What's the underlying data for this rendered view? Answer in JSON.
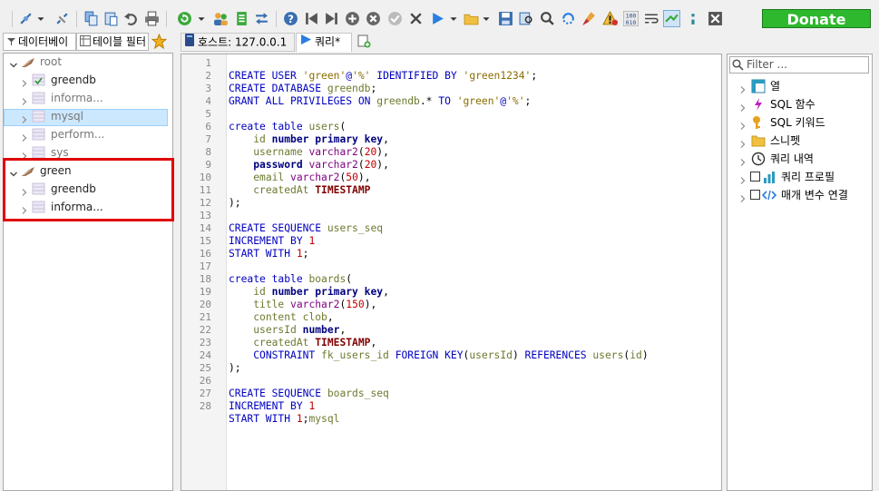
{
  "app": {
    "donate_label": "Donate"
  },
  "colors": {
    "accent_green": "#2db82d",
    "selection_blue": "#cce8ff",
    "highlight_red": "#e00000",
    "keyword_blue": "#0000c0"
  },
  "toolbar_icons": [
    "connect-icon",
    "dropdown-arrow-icon",
    "disconnect-icon",
    "copy-icon",
    "paste-icon",
    "undo-icon",
    "print-icon",
    "refresh-icon",
    "dropdown-arrow-icon",
    "user-manager-icon",
    "export-icon",
    "transfer-icon",
    "help-icon",
    "first-record-icon",
    "last-record-icon",
    "add-record-icon",
    "delete-record-icon",
    "apply-icon",
    "cancel-icon",
    "run-icon",
    "dropdown-arrow-icon",
    "open-folder-icon",
    "dropdown-arrow-icon",
    "save-icon",
    "find-icon",
    "replace-icon",
    "search-icon",
    "clean-icon",
    "warning-icon",
    "binary-icon",
    "wrap-icon",
    "sync-icon",
    "comment-icon",
    "close-icon"
  ],
  "left_tabs": [
    {
      "label": "데이터베이"
    },
    {
      "label": "테이블 필터"
    }
  ],
  "query_tabs": [
    {
      "label": "호스트: 127.0.0.1"
    },
    {
      "label": "쿼리*"
    }
  ],
  "tree": {
    "root": {
      "label": "root",
      "children": [
        "greendb",
        "informa...",
        "mysql",
        "perform...",
        "sys"
      ]
    },
    "green": {
      "label": "green",
      "children": [
        "greendb",
        "informa..."
      ]
    }
  },
  "editor": {
    "lines": [
      "1",
      "2",
      "3",
      "4",
      "5",
      "6",
      "7",
      "8",
      "9",
      "10",
      "11",
      "12",
      "13",
      "14",
      "15",
      "16",
      "17",
      "18",
      "19",
      "20",
      "21",
      "22",
      "23",
      "24",
      "25",
      "26",
      "27",
      "28"
    ]
  },
  "right_panel": {
    "filter_placeholder": "Filter ...",
    "items": [
      {
        "label": "열"
      },
      {
        "label": "SQL 함수"
      },
      {
        "label": "SQL 키워드"
      },
      {
        "label": "스니펫"
      },
      {
        "label": "쿼리 내역"
      },
      {
        "label": "쿼리 프로필"
      },
      {
        "label": "매개 변수 연결"
      }
    ]
  }
}
